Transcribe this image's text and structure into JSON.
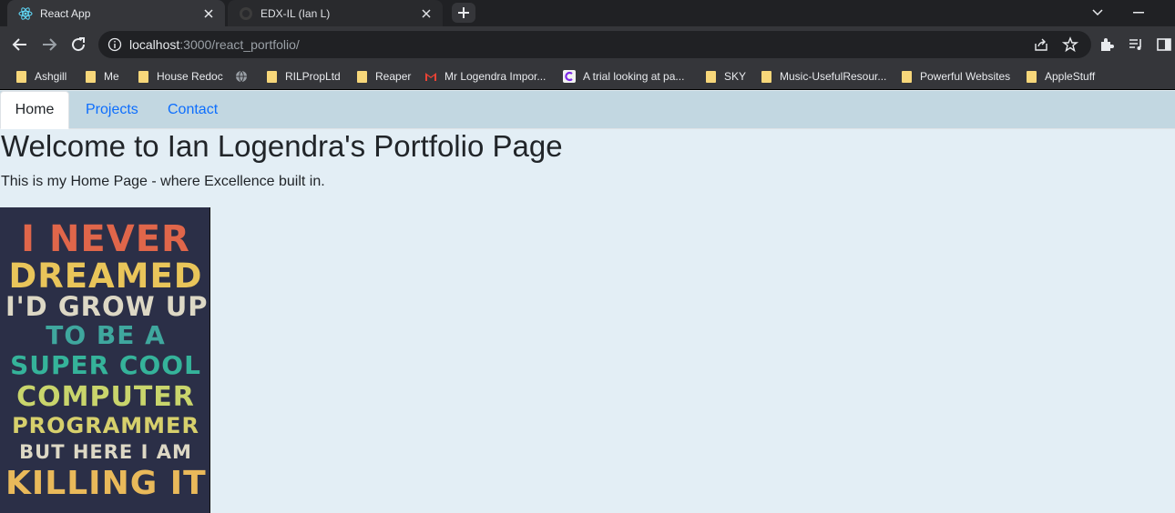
{
  "browser": {
    "tabs": [
      {
        "title": "React App",
        "active": true
      },
      {
        "title": "EDX-IL (Ian L)",
        "active": false
      }
    ],
    "address": {
      "host": "localhost",
      "rest": ":3000/react_portfolio/"
    },
    "bookmarks": [
      {
        "label": "Ashgill",
        "icon": "folder-icon"
      },
      {
        "label": "Me",
        "icon": "folder-icon"
      },
      {
        "label": "House Redoc",
        "icon": "folder-icon"
      },
      {
        "label": "",
        "icon": "globe-icon"
      },
      {
        "label": "RILPropLtd",
        "icon": "folder-icon"
      },
      {
        "label": "Reaper",
        "icon": "folder-icon"
      },
      {
        "label": "Mr Logendra Impor...",
        "icon": "gmail-icon"
      },
      {
        "label": "A trial looking at pa...",
        "icon": "canva-icon"
      },
      {
        "label": "SKY",
        "icon": "folder-icon"
      },
      {
        "label": "Music-UsefulResour...",
        "icon": "folder-icon"
      },
      {
        "label": "Powerful Websites",
        "icon": "folder-icon"
      },
      {
        "label": "AppleStuff",
        "icon": "folder-icon"
      }
    ],
    "colors": {
      "tabstrip": "#202124",
      "toolbar": "#35363a"
    }
  },
  "nav": {
    "items": [
      "Home",
      "Projects",
      "Contact"
    ],
    "active": "Home"
  },
  "page": {
    "heading": "Welcome to Ian Logendra's Portfolio Page",
    "intro": "This is my Home Page - where Excellence built in.",
    "poster_lines": [
      "I NEVER",
      "DREAMED",
      "I'D GROW UP",
      "TO BE A",
      "SUPER COOL",
      "COMPUTER",
      "PROGRAMMER",
      "BUT HERE I AM",
      "KILLING IT"
    ],
    "poster_colors": [
      "#e0664a",
      "#e9c55a",
      "#ddd8c5",
      "#3fa79e",
      "#35b39a",
      "#c9d56c",
      "#d7d06c",
      "#ddd8c5",
      "#e9b95a"
    ]
  }
}
